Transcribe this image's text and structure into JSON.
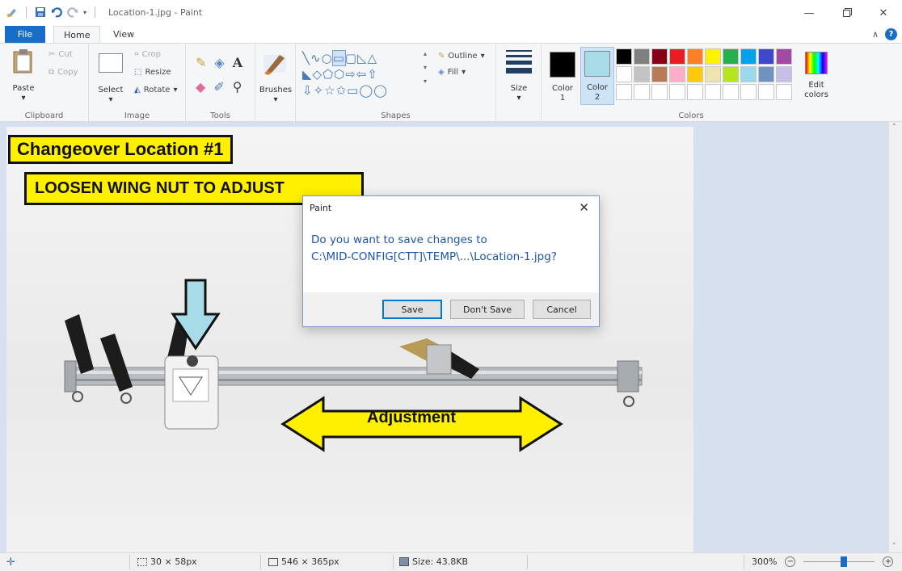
{
  "window": {
    "title": "Location-1.jpg - Paint"
  },
  "tabs": [
    {
      "label": "File"
    },
    {
      "label": "Home"
    },
    {
      "label": "View"
    }
  ],
  "ribbon": {
    "clipboard": {
      "paste": "Paste",
      "cut": "Cut",
      "copy": "Copy",
      "label": "Clipboard"
    },
    "image": {
      "select": "Select",
      "crop": "Crop",
      "resize": "Resize",
      "rotate": "Rotate",
      "label": "Image"
    },
    "tools": {
      "label": "Tools"
    },
    "brushes": {
      "label": "Brushes"
    },
    "shapes": {
      "outline": "Outline",
      "fill": "Fill",
      "label": "Shapes"
    },
    "size": {
      "label": "Size"
    },
    "colors": {
      "color1_line1": "Color",
      "color1_line2": "1",
      "color2_line1": "Color",
      "color2_line2": "2",
      "edit_line1": "Edit",
      "edit_line2": "colors",
      "label": "Colors",
      "color1": "#000000",
      "color2": "#a8dbe8",
      "palette_row1": [
        "#000000",
        "#7f7f7f",
        "#880015",
        "#ed1c24",
        "#ff7f27",
        "#fff200",
        "#22b14c",
        "#00a2e8",
        "#3f48cc",
        "#a349a4"
      ],
      "palette_row2": [
        "#ffffff",
        "#c3c3c3",
        "#b97a57",
        "#ffaec9",
        "#ffc90e",
        "#efe4b0",
        "#b5e61d",
        "#99d9ea",
        "#7092be",
        "#c8bfe7"
      ]
    }
  },
  "canvas": {
    "label1": "Changeover Location #1",
    "label2": "LOOSEN WING NUT TO ADJUST",
    "label3": "Adjustment"
  },
  "dialog": {
    "title": "Paint",
    "message_line1": "Do you want to save changes to",
    "message_line2": "C:\\MID-CONFIG[CTT]\\TEMP\\...\\Location-1.jpg?",
    "save": "Save",
    "dont_save": "Don't Save",
    "cancel": "Cancel"
  },
  "statusbar": {
    "selection": "30 × 58px",
    "image_size": "546 × 365px",
    "file_size": "Size: 43.8KB",
    "zoom": "300%"
  }
}
